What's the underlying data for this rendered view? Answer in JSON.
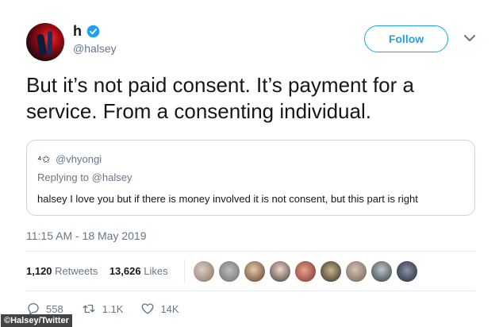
{
  "author": {
    "name": "h",
    "handle": "@halsey",
    "verified_icon": "verified-badge-icon",
    "avatar_icon": "profile-avatar"
  },
  "follow_label": "Follow",
  "tweet_text": "But it’s not paid consent. It’s payment for a service. From a consenting individual.",
  "quoted": {
    "handle_deco": "⁴✩",
    "handle": "@vhyongi",
    "replying_prefix": "Replying to",
    "replying_handle": "@halsey",
    "text": "halsey I love you but if there is money involved it is not consent, but this part is right"
  },
  "timestamp": "11:15 AM - 18 May 2019",
  "stats": {
    "retweets_count": "1,120",
    "retweets_label": "Retweets",
    "likes_count": "13,626",
    "likes_label": "Likes"
  },
  "likers_count": 9,
  "actions": {
    "replies": "558",
    "retweets": "1.1K",
    "likes": "14K"
  },
  "credit": "©Halsey/Twitter",
  "colors": {
    "accent": "#1da1f2",
    "secondary_text": "#657786",
    "border": "#ccd6dd"
  }
}
